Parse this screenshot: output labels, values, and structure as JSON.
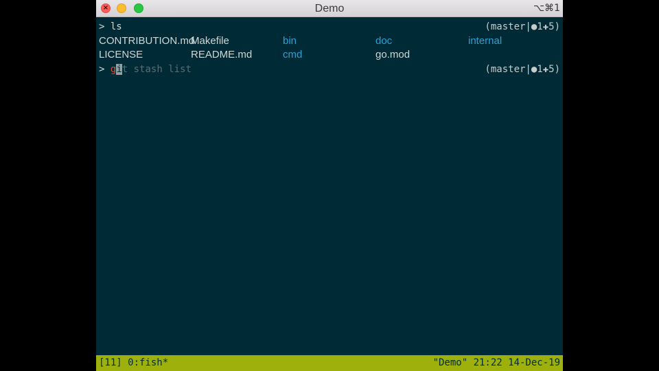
{
  "window": {
    "title": "Demo",
    "shortcut": "⌥⌘1",
    "close_glyph": "×"
  },
  "terminal": {
    "prompt_symbol": ">",
    "line1": {
      "command": "ls",
      "git_status": "(master|●1✚5)"
    },
    "listing": {
      "files": [
        "CONTRIBUTION.md",
        "Makefile",
        "LICENSE",
        "README.md",
        "go.mod"
      ],
      "dirs": [
        "bin",
        "doc",
        "internal",
        "cmd"
      ]
    },
    "line2": {
      "typed_first": "g",
      "cursor_char": "i",
      "autosuggestion": "t stash list",
      "git_status": "(master|●1✚5)"
    }
  },
  "tmux": {
    "left": "[11] 0:fish*",
    "right": "\"Demo\" 21:22 14-Dec-19"
  },
  "colors": {
    "background": "#002b36",
    "directory": "#2aa1d6",
    "status_bar": "#9db00b"
  }
}
